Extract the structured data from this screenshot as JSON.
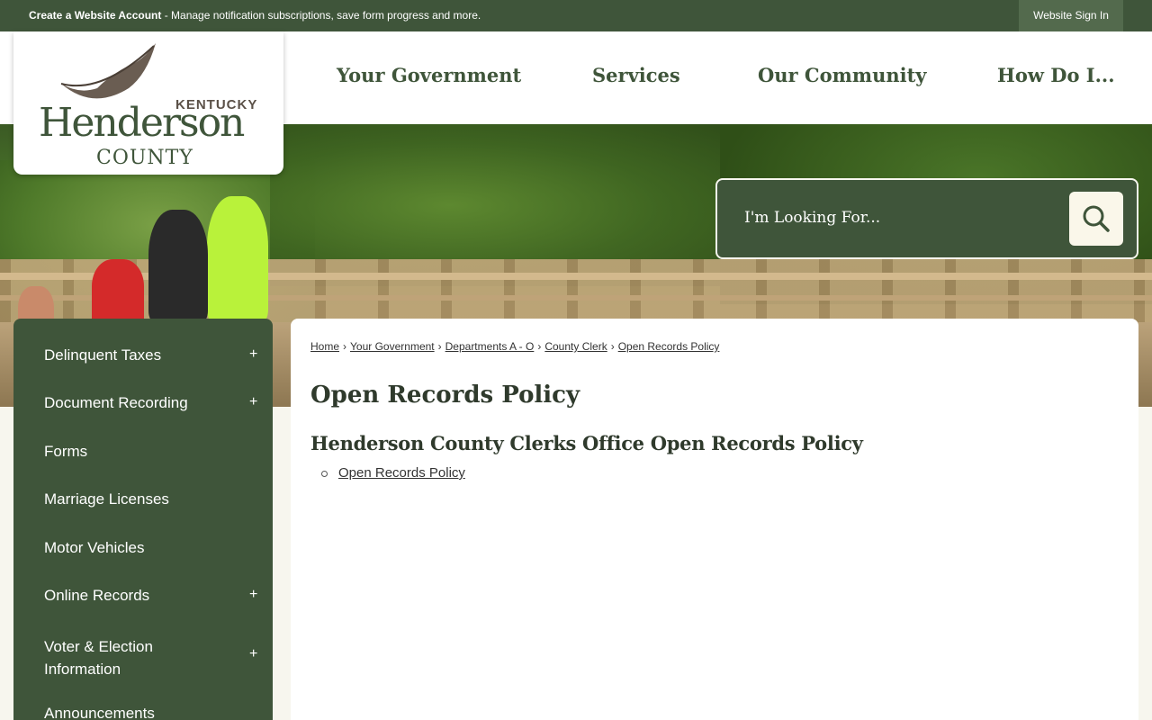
{
  "topbar": {
    "create_account_label": "Create a Website Account",
    "create_account_desc": " - Manage notification subscriptions, save form progress and more.",
    "signin_label": "Website Sign In"
  },
  "logo": {
    "state": "KENTUCKY",
    "name": "Henderson",
    "county": "COUNTY"
  },
  "nav": {
    "items": [
      "Your Government",
      "Services",
      "Our Community",
      "How Do I..."
    ]
  },
  "search": {
    "placeholder": "I'm Looking For...",
    "icon": "search-icon"
  },
  "sidebar": {
    "items": [
      {
        "label": "Delinquent Taxes",
        "expandable": true
      },
      {
        "label": "Document Recording",
        "expandable": true
      },
      {
        "label": "Forms",
        "expandable": false
      },
      {
        "label": "Marriage Licenses",
        "expandable": false
      },
      {
        "label": "Motor Vehicles",
        "expandable": false
      },
      {
        "label": "Online Records",
        "expandable": true
      },
      {
        "label": "Voter & Election Information",
        "expandable": true
      },
      {
        "label": "Announcements",
        "expandable": false
      }
    ],
    "expand_symbol": "+"
  },
  "breadcrumb": {
    "items": [
      "Home",
      "Your Government",
      "Departments A - O",
      "County Clerk",
      "Open Records Policy"
    ],
    "separator": "›"
  },
  "content": {
    "title": "Open Records Policy",
    "subheading": "Henderson County Clerks Office Open Records Policy",
    "links": [
      "Open Records Policy"
    ]
  },
  "colors": {
    "brand_green": "#3f553a",
    "background": "#f7f6ee"
  }
}
